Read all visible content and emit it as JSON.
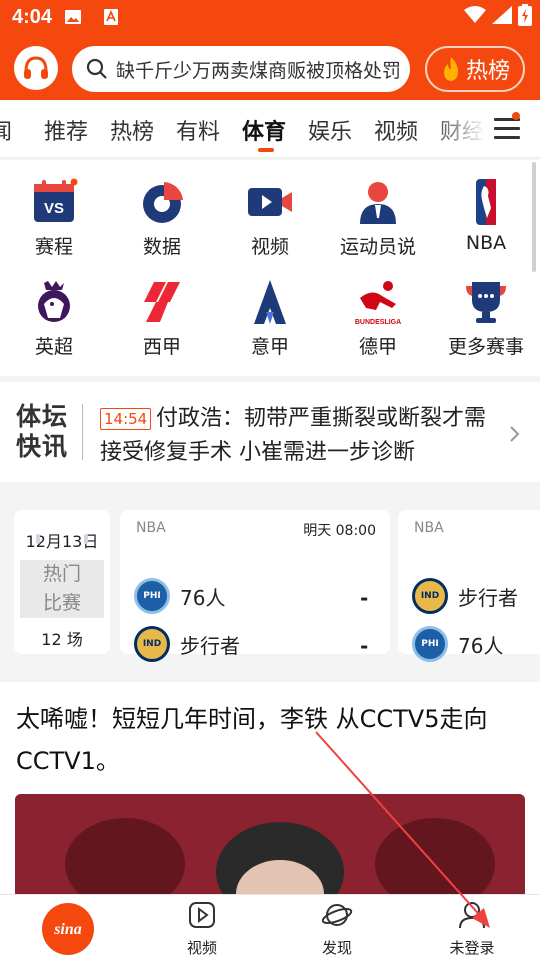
{
  "status_bar": {
    "time": "4:04"
  },
  "header": {
    "search_text": "缺千斤少万两卖煤商贩被顶格处罚",
    "hot_label": "热榜"
  },
  "tabs": [
    {
      "label": "闻"
    },
    {
      "label": "推荐"
    },
    {
      "label": "热榜"
    },
    {
      "label": "有料"
    },
    {
      "label": "体育"
    },
    {
      "label": "娱乐"
    },
    {
      "label": "视频"
    },
    {
      "label": "财经"
    }
  ],
  "sports_grid": [
    {
      "label": "赛程",
      "icon": "schedule-vs-icon"
    },
    {
      "label": "数据",
      "icon": "data-chart-icon"
    },
    {
      "label": "视频",
      "icon": "video-camera-icon"
    },
    {
      "label": "运动员说",
      "icon": "athlete-icon"
    },
    {
      "label": "NBA",
      "icon": "nba-logo-icon"
    },
    {
      "label": "英超",
      "icon": "premier-league-icon"
    },
    {
      "label": "西甲",
      "icon": "laliga-icon"
    },
    {
      "label": "意甲",
      "icon": "serie-a-icon"
    },
    {
      "label": "德甲",
      "icon": "bundesliga-icon",
      "logo_text": "BUNDESLIGA"
    },
    {
      "label": "更多赛事",
      "icon": "more-events-icon"
    }
  ],
  "flash": {
    "brand_line1": "体坛",
    "brand_line2": "快讯",
    "time": "14:54",
    "headline": "付政浩：韧带严重撕裂或断裂才需接受修复手术 小崔需进一步诊断"
  },
  "matches": {
    "date": "12月13日",
    "hot_line1": "热门",
    "hot_line2": "比赛",
    "count": "12 场",
    "cards": [
      {
        "league": "NBA",
        "time": "明天 08:00",
        "teams": [
          {
            "name": "76人",
            "score": "-",
            "badge": "PHI"
          },
          {
            "name": "步行者",
            "score": "-",
            "badge": "IND"
          }
        ]
      },
      {
        "league": "NBA",
        "time": "",
        "teams": [
          {
            "name": "步行者",
            "score": "",
            "badge": "IND"
          },
          {
            "name": "76人",
            "score": "",
            "badge": "PHI"
          }
        ]
      }
    ]
  },
  "article": {
    "title": "太唏嘘！短短几年时间，李铁 从CCTV5走向CCTV1。"
  },
  "bottom_nav": [
    {
      "label": "",
      "icon": "sina-logo-icon"
    },
    {
      "label": "视频",
      "icon": "play-icon"
    },
    {
      "label": "发现",
      "icon": "planet-icon"
    },
    {
      "label": "未登录",
      "icon": "user-icon"
    }
  ],
  "colors": {
    "brand": "#f4480f",
    "text": "#222222",
    "muted": "#888888"
  }
}
